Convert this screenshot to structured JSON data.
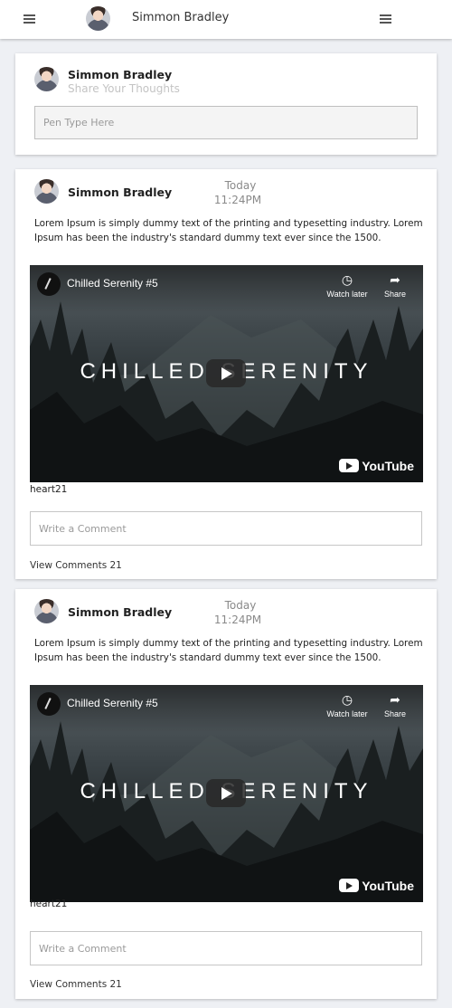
{
  "topbar": {
    "user_name": "Simmon Bradley"
  },
  "composer": {
    "user_name": "Simmon Bradley",
    "prompt": "Share Your Thoughts",
    "input_placeholder": "Pen Type Here"
  },
  "posts": [
    {
      "user_name": "Simmon Bradley",
      "date": "Today",
      "time": "11:24PM",
      "text": "Lorem Ipsum is simply dummy text of the printing and typesetting industry. Lorem Ipsum has been the industry's standard dummy text ever since the 1500.",
      "video": {
        "title": "Chilled Serenity #5",
        "overlay_text": "CHILLED SERENITY",
        "watch_later": "Watch later",
        "share": "Share",
        "brand": "YouTube"
      },
      "likes": "heart21",
      "comment_placeholder": "Write a Comment",
      "view_comments": "View Comments 21"
    },
    {
      "user_name": "Simmon Bradley",
      "date": "Today",
      "time": "11:24PM",
      "text": "Lorem Ipsum is simply dummy text of the printing and typesetting industry. Lorem Ipsum has been the industry's standard dummy text ever since the 1500.",
      "video": {
        "title": "Chilled Serenity #5",
        "overlay_text": "CHILLED SERENITY",
        "watch_later": "Watch later",
        "share": "Share",
        "brand": "YouTube"
      },
      "likes": "heart21",
      "comment_placeholder": "Write a Comment",
      "view_comments": "View Comments 21"
    }
  ]
}
